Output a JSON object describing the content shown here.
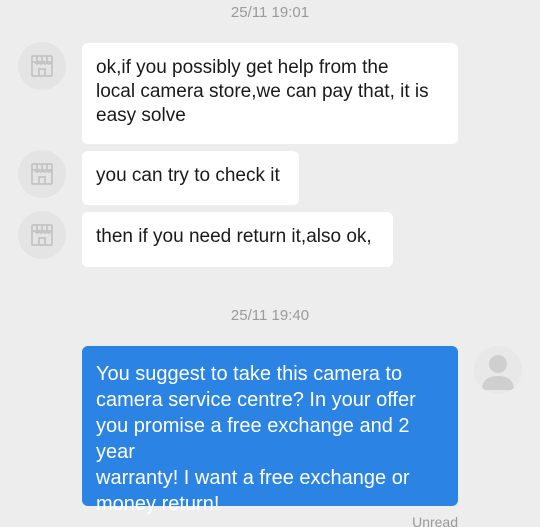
{
  "chat": {
    "timestamp_1": "25/11 19:01",
    "timestamp_2": "25/11 19:40",
    "messages": [
      {
        "sender": "seller",
        "text": "ok,if you possibly get help from the\nlocal camera store,we can pay that, it is\neasy solve"
      },
      {
        "sender": "seller",
        "text": "you can try to check it"
      },
      {
        "sender": "seller",
        "text": "then if you need return it,also ok,"
      },
      {
        "sender": "me",
        "text": "You suggest to take this camera to\ncamera service centre? In your offer\nyou promise a free exchange and 2 year\nwarranty! I want a free exchange or\nmoney return!"
      }
    ],
    "status_text": "Unread"
  },
  "icons": {
    "seller_avatar": "store-icon",
    "user_avatar": "person-icon"
  },
  "colors": {
    "background": "#ededed",
    "incoming_bubble": "#ffffff",
    "outgoing_bubble": "#2b84e3",
    "timestamp_text": "#9a9a9a"
  }
}
